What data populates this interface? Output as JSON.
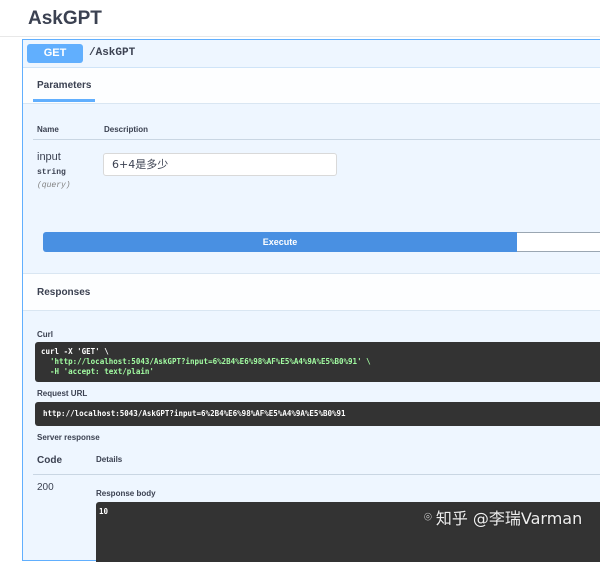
{
  "page": {
    "title": "AskGPT"
  },
  "operation": {
    "method": "GET",
    "path": "/AskGPT"
  },
  "parameters": {
    "tab_label": "Parameters",
    "col_name": "Name",
    "col_description": "Description",
    "items": [
      {
        "name": "input",
        "type": "string",
        "location": "(query)",
        "value": "6+4是多少"
      }
    ]
  },
  "actions": {
    "execute_label": "Execute"
  },
  "responses": {
    "title": "Responses",
    "curl_label": "Curl",
    "curl_lines": [
      "curl -X 'GET' \\",
      "  'http://localhost:5043/AskGPT?input=6%2B4%E6%98%AF%E5%A4%9A%E5%B0%91' \\",
      "  -H 'accept: text/plain'"
    ],
    "request_url_label": "Request URL",
    "request_url": "http://localhost:5043/AskGPT?input=6%2B4%E6%98%AF%E5%A4%9A%E5%B0%91",
    "server_response_label": "Server response",
    "code_header": "Code",
    "details_header": "Details",
    "status_code": "200",
    "response_body_label": "Response body",
    "response_body": "10"
  },
  "watermark": {
    "text": "知乎 @李瑞Varman",
    "icon": "camera-icon"
  },
  "colors": {
    "get_accent": "#61affe",
    "get_background": "#eef6ff",
    "execute": "#4990e2",
    "code_background": "#333333",
    "curl_string": "#a2fca2"
  }
}
